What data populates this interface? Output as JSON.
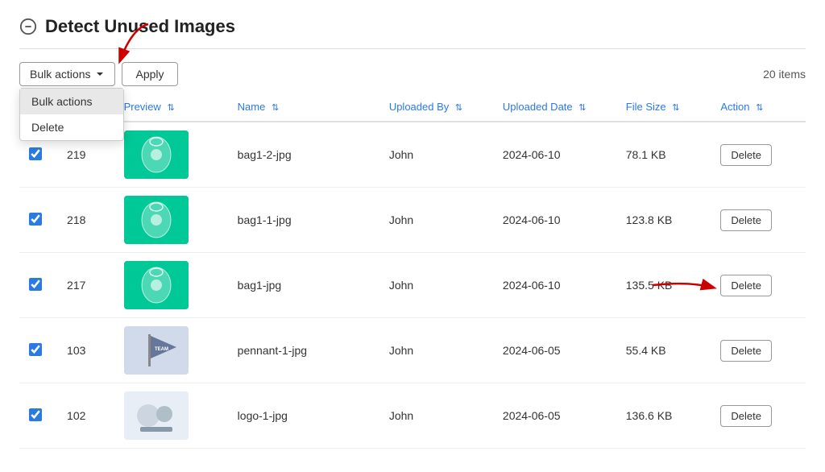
{
  "page": {
    "title": "Detect Unused Images",
    "items_count": "20 items"
  },
  "toolbar": {
    "bulk_actions_label": "Bulk actions",
    "apply_label": "Apply",
    "dropdown": {
      "items": [
        {
          "label": "Bulk actions",
          "active": true
        },
        {
          "label": "Delete",
          "active": false
        }
      ]
    }
  },
  "table": {
    "columns": [
      {
        "label": "",
        "key": "checkbox"
      },
      {
        "label": "Preview",
        "key": "preview",
        "sortable": true
      },
      {
        "label": "Name",
        "key": "name",
        "sortable": true
      },
      {
        "label": "Uploaded By",
        "key": "uploaded_by",
        "sortable": true
      },
      {
        "label": "Uploaded Date",
        "key": "uploaded_date",
        "sortable": true
      },
      {
        "label": "File Size",
        "key": "file_size",
        "sortable": true
      },
      {
        "label": "Action",
        "key": "action",
        "sortable": true
      }
    ],
    "rows": [
      {
        "id": "219",
        "name": "bag1-2-jpg",
        "uploaded_by": "John",
        "uploaded_date": "2024-06-10",
        "file_size": "78.1 KB",
        "checked": true,
        "preview_type": "green-bag"
      },
      {
        "id": "218",
        "name": "bag1-1-jpg",
        "uploaded_by": "John",
        "uploaded_date": "2024-06-10",
        "file_size": "123.8 KB",
        "checked": true,
        "preview_type": "green-bag2"
      },
      {
        "id": "217",
        "name": "bag1-jpg",
        "uploaded_by": "John",
        "uploaded_date": "2024-06-10",
        "file_size": "135.5 KB",
        "checked": true,
        "preview_type": "green-bag3"
      },
      {
        "id": "103",
        "name": "pennant-1-jpg",
        "uploaded_by": "John",
        "uploaded_date": "2024-06-05",
        "file_size": "55.4 KB",
        "checked": true,
        "preview_type": "pennant"
      },
      {
        "id": "102",
        "name": "logo-1-jpg",
        "uploaded_by": "John",
        "uploaded_date": "2024-06-05",
        "file_size": "136.6 KB",
        "checked": true,
        "preview_type": "logo"
      }
    ],
    "delete_label": "Delete"
  }
}
